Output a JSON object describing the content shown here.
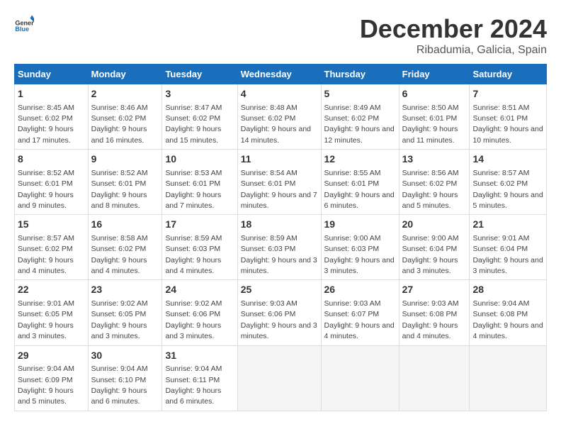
{
  "logo": {
    "general": "General",
    "blue": "Blue"
  },
  "title": "December 2024",
  "subtitle": "Ribadumia, Galicia, Spain",
  "headers": [
    "Sunday",
    "Monday",
    "Tuesday",
    "Wednesday",
    "Thursday",
    "Friday",
    "Saturday"
  ],
  "weeks": [
    [
      {
        "day": "1",
        "sunrise": "8:45 AM",
        "sunset": "6:02 PM",
        "daylight": "9 hours and 17 minutes."
      },
      {
        "day": "2",
        "sunrise": "8:46 AM",
        "sunset": "6:02 PM",
        "daylight": "9 hours and 16 minutes."
      },
      {
        "day": "3",
        "sunrise": "8:47 AM",
        "sunset": "6:02 PM",
        "daylight": "9 hours and 15 minutes."
      },
      {
        "day": "4",
        "sunrise": "8:48 AM",
        "sunset": "6:02 PM",
        "daylight": "9 hours and 14 minutes."
      },
      {
        "day": "5",
        "sunrise": "8:49 AM",
        "sunset": "6:02 PM",
        "daylight": "9 hours and 12 minutes."
      },
      {
        "day": "6",
        "sunrise": "8:50 AM",
        "sunset": "6:01 PM",
        "daylight": "9 hours and 11 minutes."
      },
      {
        "day": "7",
        "sunrise": "8:51 AM",
        "sunset": "6:01 PM",
        "daylight": "9 hours and 10 minutes."
      }
    ],
    [
      {
        "day": "8",
        "sunrise": "8:52 AM",
        "sunset": "6:01 PM",
        "daylight": "9 hours and 9 minutes."
      },
      {
        "day": "9",
        "sunrise": "8:52 AM",
        "sunset": "6:01 PM",
        "daylight": "9 hours and 8 minutes."
      },
      {
        "day": "10",
        "sunrise": "8:53 AM",
        "sunset": "6:01 PM",
        "daylight": "9 hours and 7 minutes."
      },
      {
        "day": "11",
        "sunrise": "8:54 AM",
        "sunset": "6:01 PM",
        "daylight": "9 hours and 7 minutes."
      },
      {
        "day": "12",
        "sunrise": "8:55 AM",
        "sunset": "6:01 PM",
        "daylight": "9 hours and 6 minutes."
      },
      {
        "day": "13",
        "sunrise": "8:56 AM",
        "sunset": "6:02 PM",
        "daylight": "9 hours and 5 minutes."
      },
      {
        "day": "14",
        "sunrise": "8:57 AM",
        "sunset": "6:02 PM",
        "daylight": "9 hours and 5 minutes."
      }
    ],
    [
      {
        "day": "15",
        "sunrise": "8:57 AM",
        "sunset": "6:02 PM",
        "daylight": "9 hours and 4 minutes."
      },
      {
        "day": "16",
        "sunrise": "8:58 AM",
        "sunset": "6:02 PM",
        "daylight": "9 hours and 4 minutes."
      },
      {
        "day": "17",
        "sunrise": "8:59 AM",
        "sunset": "6:03 PM",
        "daylight": "9 hours and 4 minutes."
      },
      {
        "day": "18",
        "sunrise": "8:59 AM",
        "sunset": "6:03 PM",
        "daylight": "9 hours and 3 minutes."
      },
      {
        "day": "19",
        "sunrise": "9:00 AM",
        "sunset": "6:03 PM",
        "daylight": "9 hours and 3 minutes."
      },
      {
        "day": "20",
        "sunrise": "9:00 AM",
        "sunset": "6:04 PM",
        "daylight": "9 hours and 3 minutes."
      },
      {
        "day": "21",
        "sunrise": "9:01 AM",
        "sunset": "6:04 PM",
        "daylight": "9 hours and 3 minutes."
      }
    ],
    [
      {
        "day": "22",
        "sunrise": "9:01 AM",
        "sunset": "6:05 PM",
        "daylight": "9 hours and 3 minutes."
      },
      {
        "day": "23",
        "sunrise": "9:02 AM",
        "sunset": "6:05 PM",
        "daylight": "9 hours and 3 minutes."
      },
      {
        "day": "24",
        "sunrise": "9:02 AM",
        "sunset": "6:06 PM",
        "daylight": "9 hours and 3 minutes."
      },
      {
        "day": "25",
        "sunrise": "9:03 AM",
        "sunset": "6:06 PM",
        "daylight": "9 hours and 3 minutes."
      },
      {
        "day": "26",
        "sunrise": "9:03 AM",
        "sunset": "6:07 PM",
        "daylight": "9 hours and 4 minutes."
      },
      {
        "day": "27",
        "sunrise": "9:03 AM",
        "sunset": "6:08 PM",
        "daylight": "9 hours and 4 minutes."
      },
      {
        "day": "28",
        "sunrise": "9:04 AM",
        "sunset": "6:08 PM",
        "daylight": "9 hours and 4 minutes."
      }
    ],
    [
      {
        "day": "29",
        "sunrise": "9:04 AM",
        "sunset": "6:09 PM",
        "daylight": "9 hours and 5 minutes."
      },
      {
        "day": "30",
        "sunrise": "9:04 AM",
        "sunset": "6:10 PM",
        "daylight": "9 hours and 6 minutes."
      },
      {
        "day": "31",
        "sunrise": "9:04 AM",
        "sunset": "6:11 PM",
        "daylight": "9 hours and 6 minutes."
      },
      null,
      null,
      null,
      null
    ]
  ]
}
